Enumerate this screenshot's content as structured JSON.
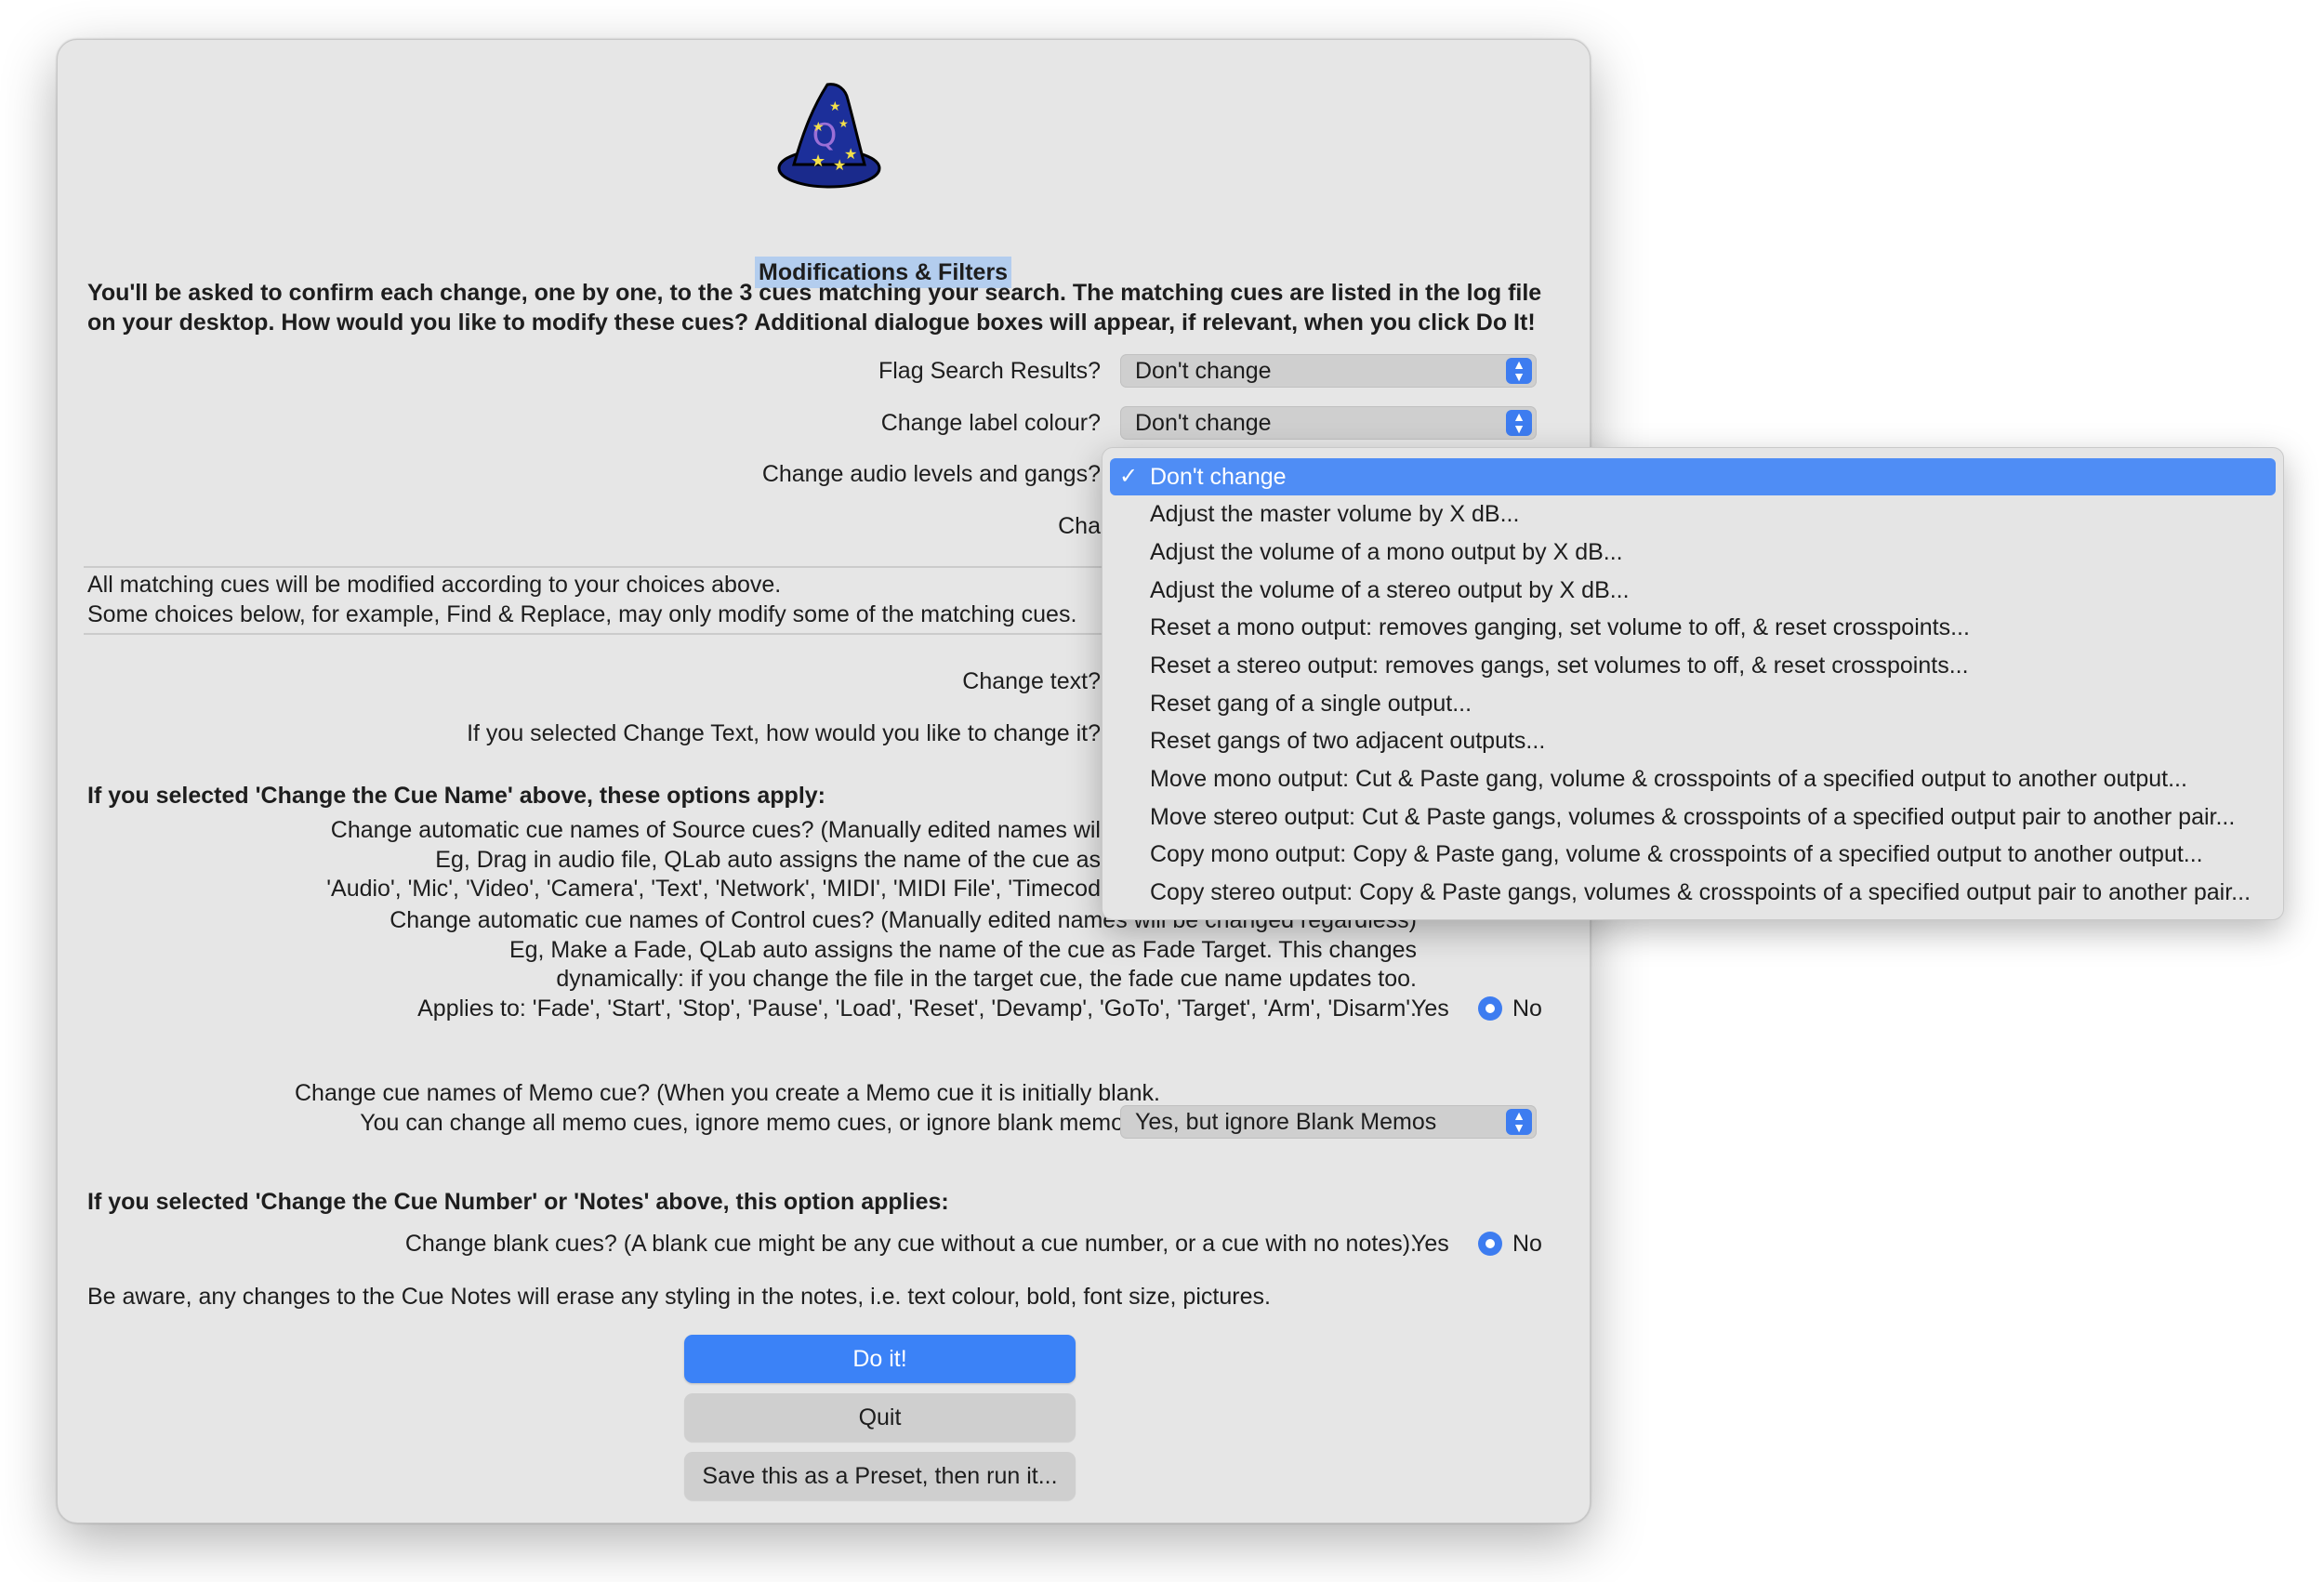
{
  "dialog": {
    "title": "Modifications & Filters",
    "intro_line1": "You'll be asked to confirm each change, one by one, to the 3 cues matching your search. The matching cues are listed in the log file",
    "intro_line2": "on your desktop. How would you like to modify these cues? Additional dialogue boxes will appear, if relevant, when you click Do It!",
    "flag_label": "Flag Search Results?",
    "flag_value": "Don't change",
    "colour_label": "Change label colour?",
    "colour_value": "Don't change",
    "audio_label": "Change audio levels and gangs?",
    "partial_label": "Cha",
    "note_line1": "All matching cues will be modified according to your choices above.",
    "note_line2": "Some choices below, for example, Find & Replace, may only modify some of the matching cues.",
    "change_text_label": "Change text?",
    "change_text_how_label": "If you selected Change Text, how would you like to change it?",
    "cue_name_heading": "If you selected 'Change the Cue Name' above, these options apply:",
    "source_line1": "Change automatic cue names of Source cues? (Manually edited names wil",
    "source_line2": "Eg, Drag in audio file, QLab auto assigns the name of the cue as",
    "source_line3": "'Audio', 'Mic', 'Video', 'Camera', 'Text', 'Network', 'MIDI', 'MIDI File', 'Timecod",
    "control_line1": "Change automatic cue names of Control cues? (Manually edited names will be changed regardless)",
    "control_line2": "Eg, Make a Fade, QLab auto assigns the name of the cue as Fade Target. This changes",
    "control_line3": "dynamically: if you change the file in the target cue, the fade cue name updates too.",
    "control_line4": "Applies to: 'Fade', 'Start', 'Stop', 'Pause', 'Load', 'Reset', 'Devamp', 'GoTo', 'Target', 'Arm', 'Disarm'.",
    "yes_label": "Yes",
    "no_label": "No",
    "memo_line1": "Change cue names of Memo cue? (When you create a Memo cue it is initially blank.",
    "memo_line2": "You can change all memo cues, ignore memo cues, or ignore blank memo cues).",
    "memo_value": "Yes, but ignore Blank Memos",
    "cue_number_heading": "If you selected 'Change the Cue Number' or 'Notes' above, this option applies:",
    "blank_label": "Change blank cues? (A blank cue might be any cue without a cue number, or a cue with no notes).",
    "warning": "Be aware, any changes to the Cue Notes will erase any styling in the notes, i.e. text colour, bold, font size, pictures.",
    "do_it": "Do it!",
    "quit": "Quit",
    "save_preset": "Save this as a Preset, then run it..."
  },
  "menu": {
    "checkmark": "✓",
    "items": [
      "Don't change",
      "Adjust the master volume by X dB...",
      "Adjust the volume of a mono output by X dB...",
      "Adjust the volume of a stereo output by X dB...",
      "Reset a mono output: removes ganging, set volume to off, & reset crosspoints...",
      "Reset a stereo output: removes gangs, set volumes to off, & reset crosspoints...",
      "Reset gang of a single output...",
      "Reset gangs of two adjacent outputs...",
      "Move mono output: Cut & Paste gang, volume & crosspoints of a specified output to another output...",
      "Move stereo output: Cut & Paste gangs, volumes & crosspoints of a specified output pair to another pair...",
      "Copy mono output: Copy & Paste gang, volume & crosspoints of a specified output to another output...",
      "Copy stereo output: Copy & Paste gangs, volumes & crosspoints of a specified output pair to another pair..."
    ],
    "selected_index": 0
  },
  "icons": {
    "app_icon": "wizard-hat-icon",
    "popup_arrows": "up-down-chevron-icon"
  },
  "colors": {
    "accent": "#3b82f7",
    "selection": "#4f8df5",
    "hat": "#1c2f9a",
    "star": "#f3e04a"
  }
}
